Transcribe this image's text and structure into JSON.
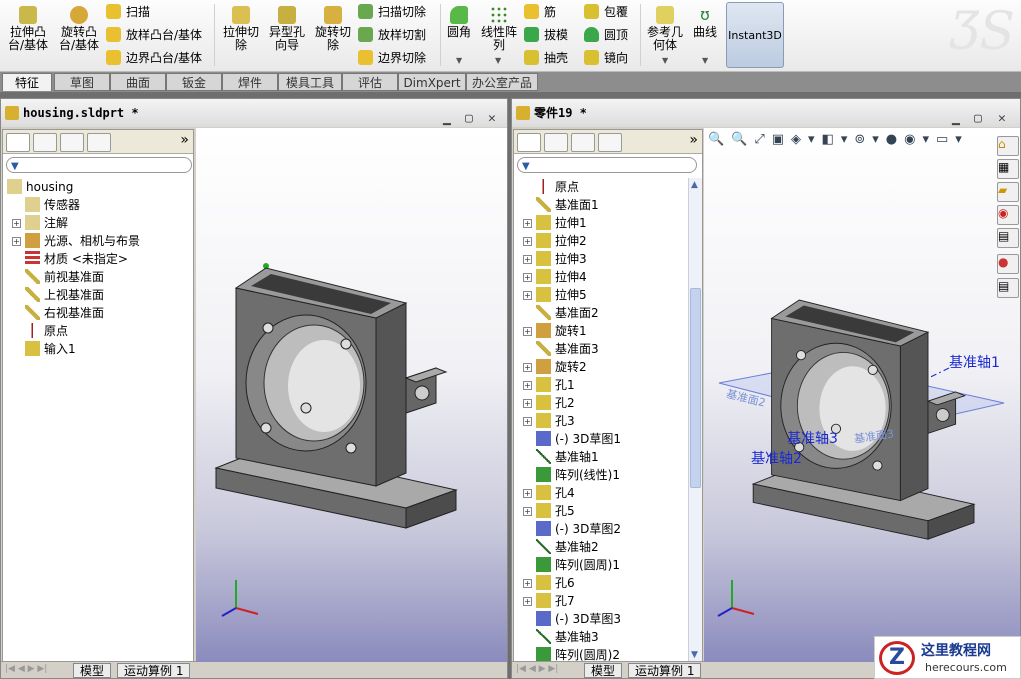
{
  "ribbon": {
    "big": [
      {
        "label": "拉伸凸\n台/基体",
        "icon": "extrude-boss-icon"
      },
      {
        "label": "旋转凸\n台/基体",
        "icon": "revolve-boss-icon"
      },
      {
        "label": "拉伸切\n除",
        "icon": "extrude-cut-icon"
      },
      {
        "label": "异型孔\n向导",
        "icon": "hole-wizard-icon"
      },
      {
        "label": "旋转切\n除",
        "icon": "revolve-cut-icon"
      },
      {
        "label": "圆角",
        "icon": "fillet-icon"
      },
      {
        "label": "线性阵\n列",
        "icon": "linear-pattern-icon"
      },
      {
        "label": "参考几\n何体",
        "icon": "reference-geometry-icon"
      },
      {
        "label": "曲线",
        "icon": "curves-icon"
      }
    ],
    "small": [
      {
        "label": "扫描"
      },
      {
        "label": "放样凸台/基体"
      },
      {
        "label": "边界凸台/基体"
      },
      {
        "label": "扫描切除"
      },
      {
        "label": "放样切割"
      },
      {
        "label": "边界切除"
      },
      {
        "label": "筋"
      },
      {
        "label": "拔模"
      },
      {
        "label": "抽壳"
      },
      {
        "label": "包覆"
      },
      {
        "label": "圆顶"
      },
      {
        "label": "镜向"
      }
    ],
    "instant3d": "Instant3D"
  },
  "tabs": [
    "特征",
    "草图",
    "曲面",
    "钣金",
    "焊件",
    "模具工具",
    "评估",
    "DimXpert",
    "办公室产品"
  ],
  "left_window": {
    "title": "housing.sldprt *",
    "tree": [
      "housing",
      "传感器",
      "注解",
      "光源、相机与布景",
      "材质 <未指定>",
      "前视基准面",
      "上视基准面",
      "右视基准面",
      "原点",
      "输入1"
    ],
    "bottom_tabs": [
      "模型",
      "运动算例 1"
    ]
  },
  "right_window": {
    "title": "零件19 *",
    "tree": [
      "原点",
      "基准面1",
      "拉伸1",
      "拉伸2",
      "拉伸3",
      "拉伸4",
      "拉伸5",
      "基准面2",
      "旋转1",
      "基准面3",
      "旋转2",
      "孔1",
      "孔2",
      "孔3",
      "(-) 3D草图1",
      "基准轴1",
      "阵列(线性)1",
      "孔4",
      "孔5",
      "(-) 3D草图2",
      "基准轴2",
      "阵列(圆周)1",
      "孔6",
      "孔7",
      "(-) 3D草图3",
      "基准轴3",
      "阵列(圆周)2"
    ],
    "bottom_tabs": [
      "模型",
      "运动算例 1"
    ],
    "annotations": [
      "基准轴1",
      "基准轴3",
      "基准轴2"
    ],
    "plane_labels": [
      "基准面2",
      "基准面3"
    ]
  },
  "watermark": {
    "title": "这里教程网",
    "url": "herecours.com"
  },
  "colors": {
    "accent": "#2222cc",
    "viewport_bottom": "#8b8bbd"
  }
}
